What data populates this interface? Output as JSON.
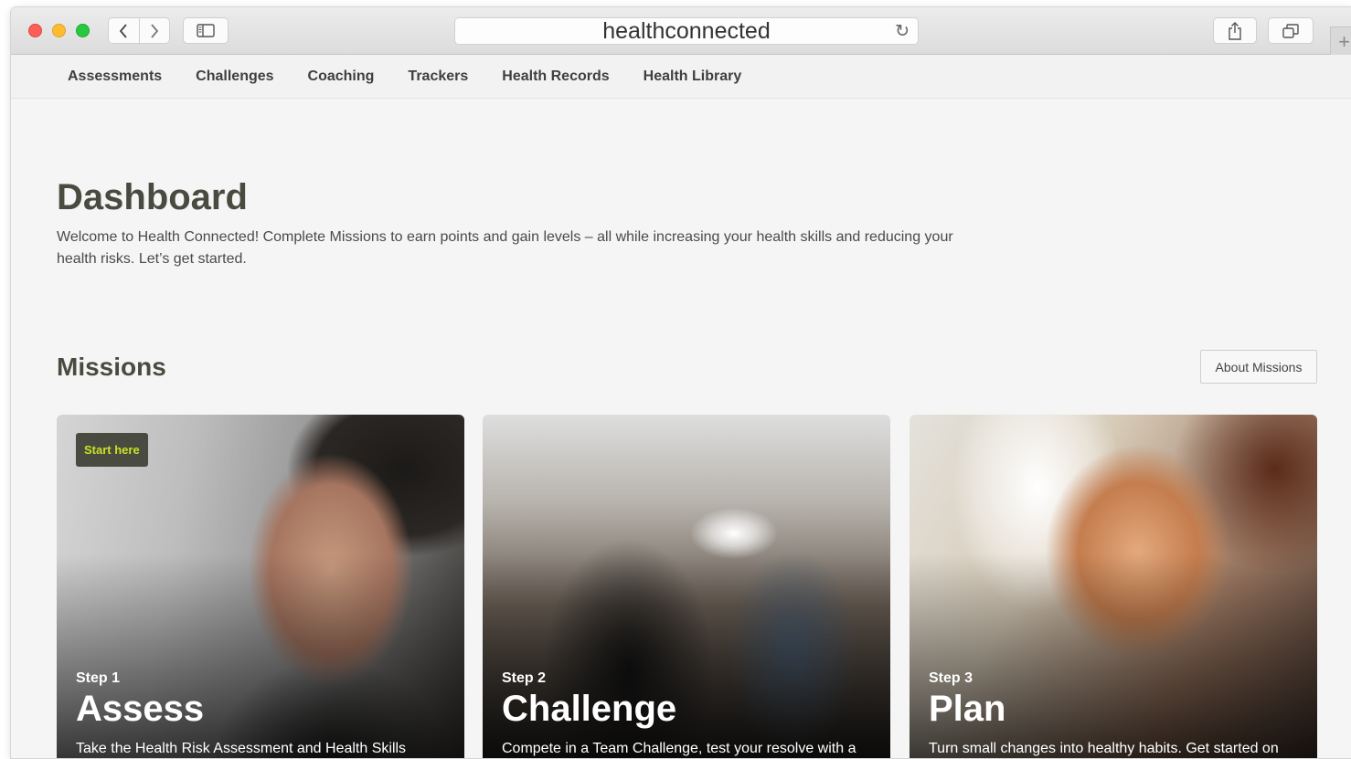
{
  "browser": {
    "url": "healthconnected",
    "icons": {
      "back": "chevron-left-icon",
      "forward": "chevron-right-icon",
      "sidebar": "sidebar-icon",
      "reload": "reload-icon",
      "share": "share-icon",
      "tabs": "tabs-icon",
      "new_tab": "plus-icon"
    }
  },
  "nav": {
    "items": [
      {
        "label": "Assessments"
      },
      {
        "label": "Challenges"
      },
      {
        "label": "Coaching"
      },
      {
        "label": "Trackers"
      },
      {
        "label": "Health Records"
      },
      {
        "label": "Health Library"
      }
    ]
  },
  "dashboard": {
    "title": "Dashboard",
    "welcome": "Welcome to Health Connected! Complete Missions to earn points and gain levels – all while increasing your health skills and reducing your health risks. Let’s get started."
  },
  "missions": {
    "title": "Missions",
    "about_label": "About Missions",
    "cards": [
      {
        "badge": "Start here",
        "step": "Step 1",
        "name": "Assess",
        "desc": "Take the Health Risk Assessment and Health Skills"
      },
      {
        "step": "Step 2",
        "name": "Challenge",
        "desc": "Compete in a Team Challenge, test your resolve with a"
      },
      {
        "step": "Step 3",
        "name": "Plan",
        "desc": "Turn small changes into healthy habits. Get started on"
      }
    ]
  },
  "colors": {
    "brand_dark": "#4a4b40",
    "badge_text": "#c9e224"
  }
}
